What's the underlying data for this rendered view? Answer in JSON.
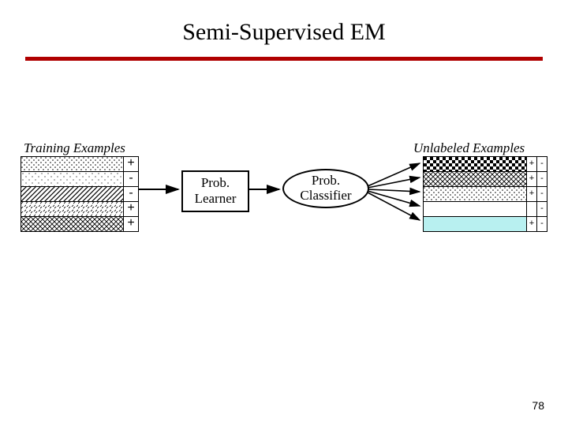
{
  "title": "Semi-Supervised EM",
  "labels": {
    "training": "Training Examples",
    "unlabeled": "Unlabeled Examples"
  },
  "training_rows": [
    {
      "pattern": "p-dots",
      "label": "+"
    },
    {
      "pattern": "p-dots2",
      "label": "-"
    },
    {
      "pattern": "p-diag",
      "label": "-"
    },
    {
      "pattern": "p-diag2",
      "label": "+"
    },
    {
      "pattern": "p-cross",
      "label": "+"
    }
  ],
  "unlabeled_rows": [
    {
      "pattern": "p-check",
      "pos": "+",
      "neg": "-"
    },
    {
      "pattern": "p-cross",
      "pos": "+",
      "neg": "-"
    },
    {
      "pattern": "p-dots",
      "pos": "+",
      "neg": "-"
    },
    {
      "pattern": "p-plain",
      "pos": "",
      "neg": "-"
    },
    {
      "pattern": "p-cyan",
      "pos": "+",
      "neg": "-"
    }
  ],
  "learner": {
    "line1": "Prob.",
    "line2": "Learner"
  },
  "classifier": {
    "line1": "Prob.",
    "line2": "Classifier"
  },
  "page_number": "78",
  "colors": {
    "rule": "#b00000"
  }
}
